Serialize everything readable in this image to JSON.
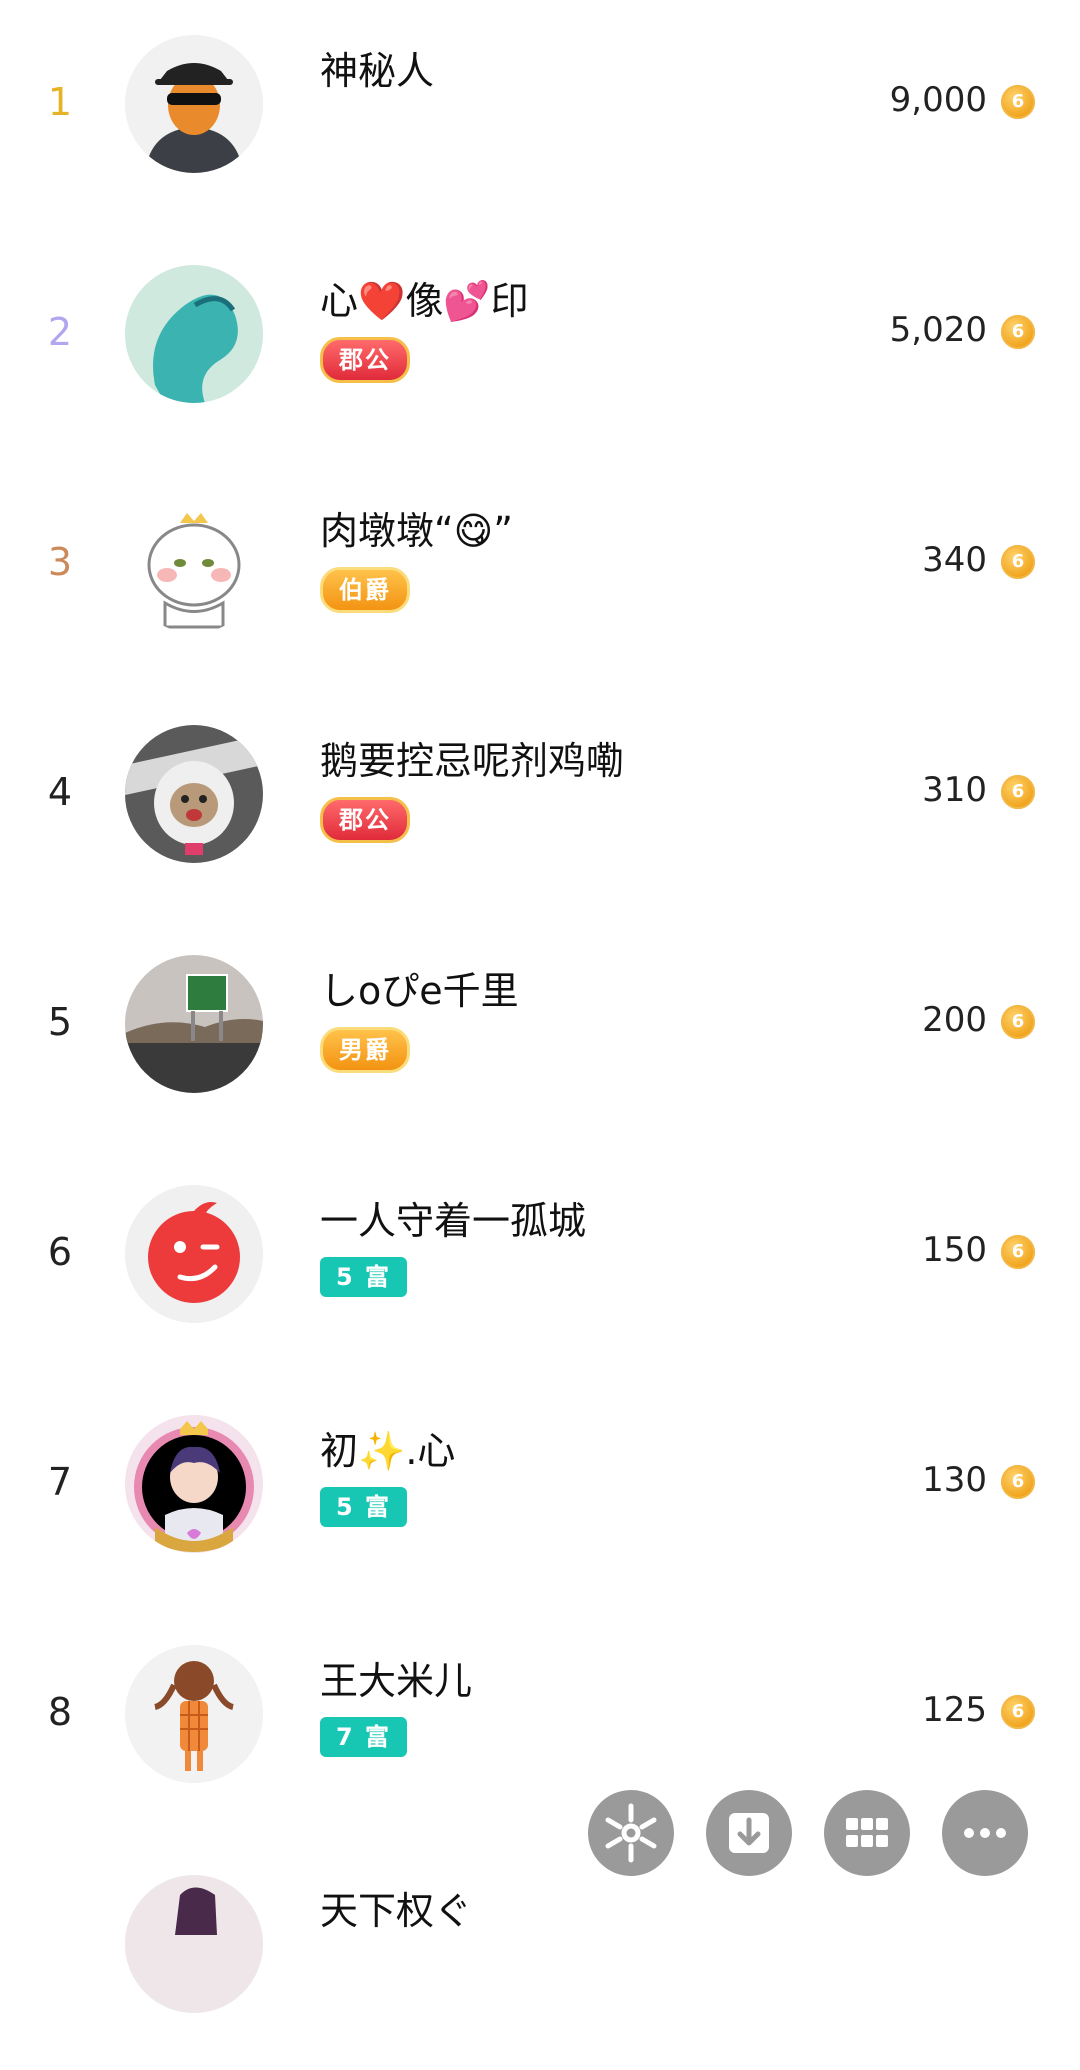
{
  "entries": [
    {
      "rank": "1",
      "name": "神秘人",
      "badge": "",
      "score": "9,000"
    },
    {
      "rank": "2",
      "name": "心❤️像💕印",
      "badge": "郡公",
      "score": "5,020"
    },
    {
      "rank": "3",
      "name": "肉墩墩“😋”",
      "badge": "伯爵",
      "score": "340"
    },
    {
      "rank": "4",
      "name": "鹅要控忌呢剂鸡嘞",
      "badge": "郡公",
      "score": "310"
    },
    {
      "rank": "5",
      "name": "しoぴe千里",
      "badge": "男爵",
      "score": "200"
    },
    {
      "rank": "6",
      "name": "一人守着一孤城",
      "badge": "5 富",
      "score": "150"
    },
    {
      "rank": "7",
      "name": "初✨.心",
      "badge": "5 富",
      "score": "130"
    },
    {
      "rank": "8",
      "name": "王大米儿",
      "badge": "7 富",
      "score": "125"
    },
    {
      "rank": "",
      "name": "天下权ぐ",
      "badge": "",
      "score": ""
    }
  ],
  "coin_glyph": "6",
  "actions": [
    {
      "name": "share-icon"
    },
    {
      "name": "download-icon"
    },
    {
      "name": "grid-icon"
    },
    {
      "name": "more-icon"
    }
  ]
}
